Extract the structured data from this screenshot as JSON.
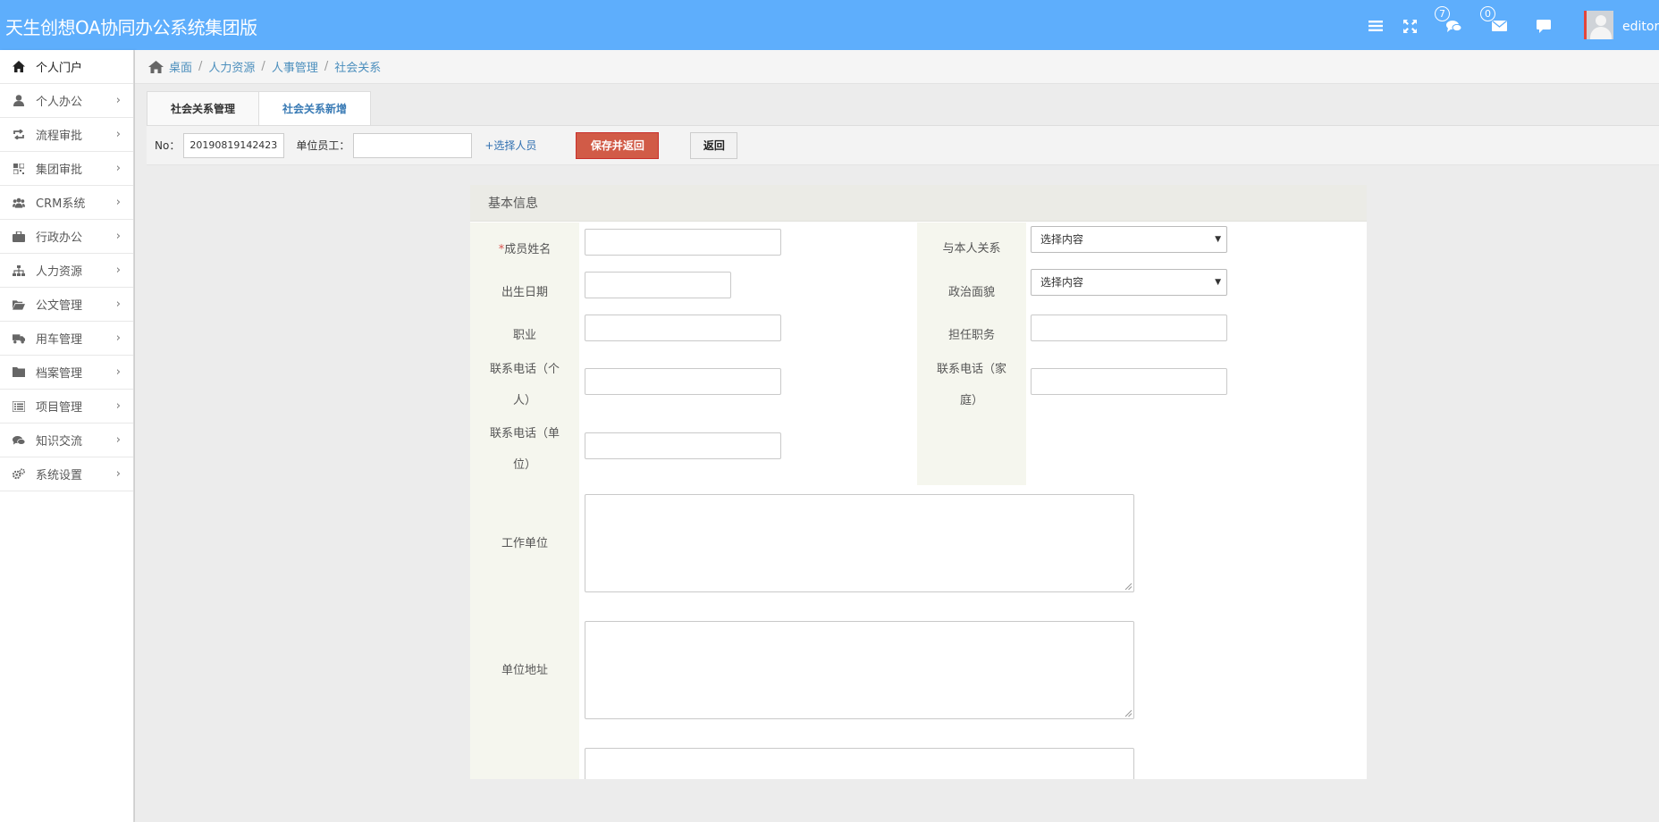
{
  "app": {
    "title": "天生创想OA协同办公系统集团版"
  },
  "topbar": {
    "messages_badge": "7",
    "mail_badge": "0",
    "username": "editor"
  },
  "sidebar": {
    "items": [
      {
        "label": "个人门户",
        "icon": "home-icon"
      },
      {
        "label": "个人办公",
        "icon": "user-icon"
      },
      {
        "label": "流程审批",
        "icon": "retweet-icon"
      },
      {
        "label": "集团审批",
        "icon": "qrcode-icon"
      },
      {
        "label": "CRM系统",
        "icon": "group-icon"
      },
      {
        "label": "行政办公",
        "icon": "briefcase-icon"
      },
      {
        "label": "人力资源",
        "icon": "sitemap-icon"
      },
      {
        "label": "公文管理",
        "icon": "folder-open-icon"
      },
      {
        "label": "用车管理",
        "icon": "truck-icon"
      },
      {
        "label": "档案管理",
        "icon": "folder-icon"
      },
      {
        "label": "项目管理",
        "icon": "list-icon"
      },
      {
        "label": "知识交流",
        "icon": "comments-icon"
      },
      {
        "label": "系统设置",
        "icon": "cogs-icon"
      }
    ]
  },
  "breadcrumb": [
    "桌面",
    "人力资源",
    "人事管理",
    "社会关系"
  ],
  "tabs": [
    "社会关系管理",
    "社会关系新增"
  ],
  "toolbar": {
    "no_label": "No：",
    "no_value": "20190819142423",
    "employee_label": "单位员工：",
    "pick_label": "+选择人员",
    "save_label": "保存并返回",
    "back_label": "返回"
  },
  "form": {
    "section_title": "基本信息",
    "required_mark": "*",
    "name_label": "成员姓名",
    "relation_label": "与本人关系",
    "relation_value": "选择内容",
    "birth_label": "出生日期",
    "political_label": "政治面貌",
    "political_value": "选择内容",
    "job_label": "职业",
    "position_label": "担任职务",
    "phone_personal_label_1": "联系电话（个",
    "phone_personal_label_2": "人）",
    "phone_home_label_1": "联系电话（家",
    "phone_home_label_2": "庭）",
    "phone_work_label_1": "联系电话（单",
    "phone_work_label_2": "位）",
    "workplace_label": "工作单位",
    "address_label": "单位地址"
  },
  "colors": {
    "topbar": "#5eaefc",
    "save_button": "#d15b47",
    "link": "#4c8fbd",
    "label_column": "#f5f6ee"
  }
}
